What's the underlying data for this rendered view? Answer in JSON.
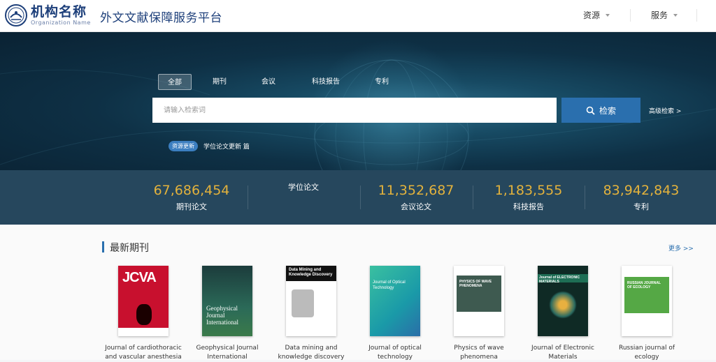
{
  "header": {
    "logo_name": "机构名称",
    "logo_en": "Organization Name",
    "site_title": "外文文献保障服务平台",
    "nav": [
      {
        "label": "资源"
      },
      {
        "label": "服务"
      }
    ]
  },
  "search": {
    "tabs": [
      {
        "label": "全部",
        "active": true
      },
      {
        "label": "期刊"
      },
      {
        "label": "会议"
      },
      {
        "label": "科技报告"
      },
      {
        "label": "专利"
      }
    ],
    "placeholder": "请输入检索词",
    "button_label": "检索",
    "advanced_label": "高级检索 >",
    "update_badge": "资源更新",
    "update_text": "学位论文更新 篇"
  },
  "stats": [
    {
      "value": "67,686,454",
      "label": "期刊论文"
    },
    {
      "value": "",
      "label": "学位论文"
    },
    {
      "value": "11,352,687",
      "label": "会议论文"
    },
    {
      "value": "1,183,555",
      "label": "科技报告"
    },
    {
      "value": "83,942,843",
      "label": "专利"
    }
  ],
  "latest": {
    "title": "最新期刊",
    "more_label": "更多 >>",
    "journals": [
      {
        "name": "Journal of cardiothoracic and vascular anesthesia",
        "cover": {
          "title": "JCVA",
          "bg": "#c8102e"
        }
      },
      {
        "name": "Geophysical Journal International",
        "cover": {
          "title": "Geophysical Journal International",
          "bg": "#1f5a4e"
        }
      },
      {
        "name": "Data mining and knowledge discovery",
        "cover": {
          "title": "Data Mining and Knowledge Discovery",
          "bg": "#ffffff"
        }
      },
      {
        "name": "Journal of optical technology",
        "cover": {
          "title": "Journal of Optical Technology",
          "bg": "#1aa6a0"
        }
      },
      {
        "name": "Physics of wave phenomena",
        "cover": {
          "title": "PHYSICS OF WAVE PHENOMENA",
          "bg": "#3e5a50"
        }
      },
      {
        "name": "Journal of Electronic Materials",
        "cover": {
          "title": "Journal of ELECTRONIC MATERIALS",
          "bg": "#1e6e55"
        }
      },
      {
        "name": "Russian journal of ecology",
        "cover": {
          "title": "RUSSIAN JOURNAL OF ECOLOGY",
          "bg": "#55a845"
        }
      }
    ]
  },
  "colors": {
    "accent": "#2a6fae",
    "stat_number": "#e3b23c",
    "stats_bg": "#26475d"
  }
}
